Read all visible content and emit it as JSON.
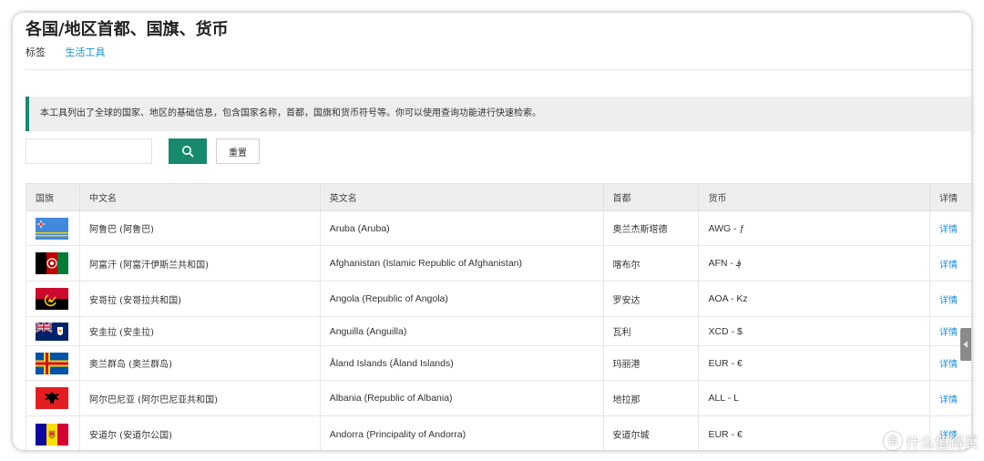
{
  "page": {
    "title": "各国/地区首都、国旗、货币",
    "tag_label": "标签",
    "tag_link": "生活工具",
    "notice": "本工具列出了全球的国家、地区的基础信息，包含国家名称，首都，国旗和货币符号等。你可以使用查询功能进行快速检索。"
  },
  "search": {
    "value": "",
    "placeholder": "",
    "reset_label": "重置",
    "icon": "search-icon"
  },
  "table": {
    "headers": {
      "flag": "国旗",
      "cn": "中文名",
      "en": "英文名",
      "capital": "首都",
      "currency": "货币",
      "detail": "详情"
    },
    "rows": [
      {
        "flag": "aruba-flag-icon",
        "cn": "阿鲁巴 (阿鲁巴)",
        "en": "Aruba (Aruba)",
        "capital": "奥兰杰斯塔德",
        "currency": "AWG - ƒ",
        "detail": "详情"
      },
      {
        "flag": "afghanistan-flag-icon",
        "cn": "阿富汗 (阿富汗伊斯兰共和国)",
        "en": "Afghanistan (Islamic Republic of Afghanistan)",
        "capital": "喀布尔",
        "currency": "AFN - ؋",
        "detail": "详情"
      },
      {
        "flag": "angola-flag-icon",
        "cn": "安哥拉 (安哥拉共和国)",
        "en": "Angola (Republic of Angola)",
        "capital": "罗安达",
        "currency": "AOA - Kz",
        "detail": "详情"
      },
      {
        "flag": "anguilla-flag-icon",
        "cn": "安圭拉 (安圭拉)",
        "en": "Anguilla (Anguilla)",
        "capital": "瓦利",
        "currency": "XCD - $",
        "detail": "详情"
      },
      {
        "flag": "aland-flag-icon",
        "cn": "奥兰群岛 (奥兰群岛)",
        "en": "Åland Islands (Åland Islands)",
        "capital": "玛丽港",
        "currency": "EUR - €",
        "detail": "详情"
      },
      {
        "flag": "albania-flag-icon",
        "cn": "阿尔巴尼亚 (阿尔巴尼亚共和国)",
        "en": "Albania (Republic of Albania)",
        "capital": "地拉那",
        "currency": "ALL - L",
        "detail": "详情"
      },
      {
        "flag": "andorra-flag-icon",
        "cn": "安道尔 (安道尔公国)",
        "en": "Andorra (Principality of Andorra)",
        "capital": "安道尔城",
        "currency": "EUR - €",
        "detail": "详情"
      }
    ]
  },
  "watermark": {
    "logo": "值",
    "text": "什么值得买"
  },
  "colors": {
    "accent": "#178a6e",
    "link": "#1a8bd6",
    "header_bg": "#eeeeee"
  }
}
